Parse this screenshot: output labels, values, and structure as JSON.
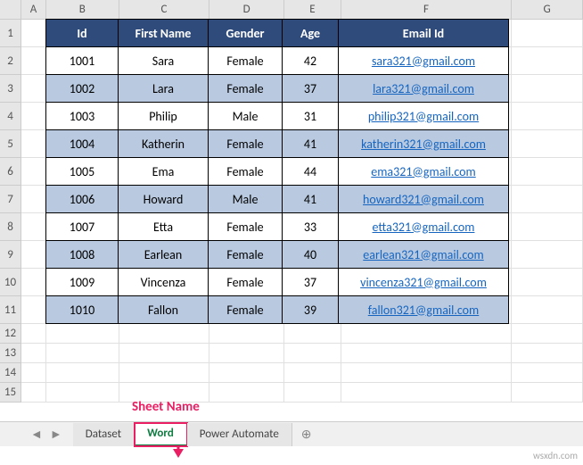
{
  "columns": [
    "A",
    "B",
    "C",
    "D",
    "E",
    "F",
    "G"
  ],
  "rowCount": 15,
  "table": {
    "headers": [
      "Id",
      "First Name",
      "Gender",
      "Age",
      "Email Id"
    ],
    "rows": [
      {
        "id": "1001",
        "first": "Sara",
        "gender": "Female",
        "age": "42",
        "email": "sara321@gmail.com"
      },
      {
        "id": "1002",
        "first": "Lara",
        "gender": "Female",
        "age": "37",
        "email": "lara321@gmail.com"
      },
      {
        "id": "1003",
        "first": "Philip",
        "gender": "Male",
        "age": "31",
        "email": "philip321@gmail.com"
      },
      {
        "id": "1004",
        "first": "Katherin",
        "gender": "Female",
        "age": "41",
        "email": "katherin321@gmail.com"
      },
      {
        "id": "1005",
        "first": "Ema",
        "gender": "Female",
        "age": "44",
        "email": "ema321@gmail.com"
      },
      {
        "id": "1006",
        "first": "Howard",
        "gender": "Male",
        "age": "41",
        "email": "howard321@gmail.com"
      },
      {
        "id": "1007",
        "first": "Etta",
        "gender": "Female",
        "age": "33",
        "email": "etta321@gmail.com"
      },
      {
        "id": "1008",
        "first": "Earlean",
        "gender": "Female",
        "age": "40",
        "email": "earlean321@gmail.com"
      },
      {
        "id": "1009",
        "first": "Vincenza",
        "gender": "Female",
        "age": "37",
        "email": "vincenza321@gmail.com"
      },
      {
        "id": "1010",
        "first": "Fallon",
        "gender": "Female",
        "age": "39",
        "email": "fallon321@gmail.com"
      }
    ]
  },
  "tabs": {
    "items": [
      "Dataset",
      "Word",
      "Power Automate"
    ],
    "activeIndex": 1,
    "newTabGlyph": "⊕"
  },
  "annotation": {
    "label": "Sheet Name"
  },
  "watermark": "wsxdn.com",
  "chart_data": {
    "type": "table",
    "title": "",
    "columns": [
      "Id",
      "First Name",
      "Gender",
      "Age",
      "Email Id"
    ],
    "rows": [
      [
        "1001",
        "Sara",
        "Female",
        42,
        "sara321@gmail.com"
      ],
      [
        "1002",
        "Lara",
        "Female",
        37,
        "lara321@gmail.com"
      ],
      [
        "1003",
        "Philip",
        "Male",
        31,
        "philip321@gmail.com"
      ],
      [
        "1004",
        "Katherin",
        "Female",
        41,
        "katherin321@gmail.com"
      ],
      [
        "1005",
        "Ema",
        "Female",
        44,
        "ema321@gmail.com"
      ],
      [
        "1006",
        "Howard",
        "Male",
        41,
        "howard321@gmail.com"
      ],
      [
        "1007",
        "Etta",
        "Female",
        33,
        "etta321@gmail.com"
      ],
      [
        "1008",
        "Earlean",
        "Female",
        40,
        "earlean321@gmail.com"
      ],
      [
        "1009",
        "Vincenza",
        "Female",
        37,
        "vincenza321@gmail.com"
      ],
      [
        "1010",
        "Fallon",
        "Female",
        39,
        "fallon321@gmail.com"
      ]
    ]
  }
}
